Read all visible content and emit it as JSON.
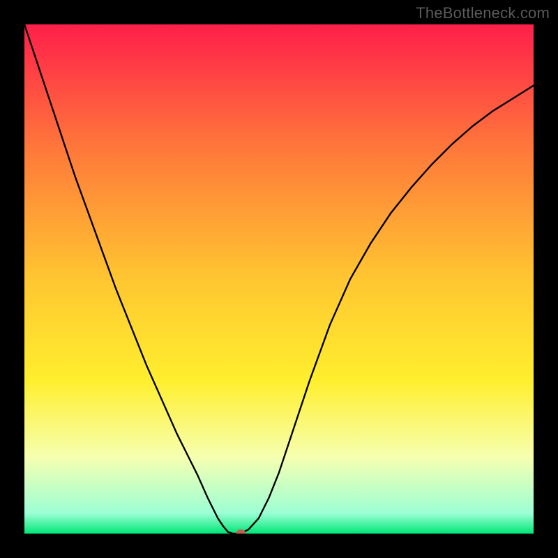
{
  "watermark": "TheBottleneck.com",
  "chart_data": {
    "type": "line",
    "title": "",
    "xlabel": "",
    "ylabel": "",
    "xlim": [
      0,
      100
    ],
    "ylim": [
      0,
      100
    ],
    "x": [
      0,
      2,
      4,
      6,
      8,
      10,
      12,
      14,
      16,
      18,
      20,
      22,
      24,
      26,
      28,
      30,
      32,
      34,
      36,
      37,
      38,
      39,
      40,
      41,
      42,
      43,
      44,
      46,
      48,
      50,
      52,
      54,
      56,
      58,
      60,
      64,
      68,
      72,
      76,
      80,
      84,
      88,
      92,
      96,
      100
    ],
    "values": [
      100,
      94,
      88,
      82,
      76,
      70,
      64.5,
      59,
      53.5,
      48,
      43,
      38,
      33,
      28.5,
      24,
      19.5,
      15.5,
      11.5,
      7,
      5,
      3,
      1.5,
      0.3,
      0,
      0,
      0.3,
      0.8,
      3,
      7,
      12,
      18,
      24,
      30,
      35.5,
      41,
      50,
      57,
      63,
      68,
      72.5,
      76.5,
      80,
      83,
      85.5,
      88
    ],
    "marker": {
      "x": 42.5,
      "y": 0
    },
    "gradient_stops": [
      {
        "offset": 0,
        "color": "#ff1f4b"
      },
      {
        "offset": 25,
        "color": "#ff7a3a"
      },
      {
        "offset": 50,
        "color": "#ffc631"
      },
      {
        "offset": 70,
        "color": "#ffef2e"
      },
      {
        "offset": 85,
        "color": "#f6ffb0"
      },
      {
        "offset": 96,
        "color": "#9cffd5"
      },
      {
        "offset": 100,
        "color": "#00e676"
      }
    ]
  }
}
